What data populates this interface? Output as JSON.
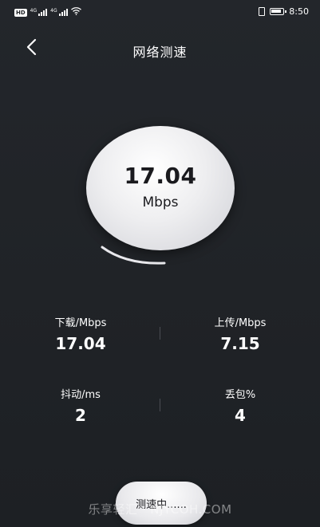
{
  "status_bar": {
    "hd_label": "HD",
    "network1_label": "4G",
    "network2_label": "4G",
    "time": "8:50"
  },
  "header": {
    "title": "网络测速"
  },
  "gauge": {
    "speed_value": "17.04",
    "speed_unit": "Mbps"
  },
  "stats": {
    "download": {
      "label": "下载/Mbps",
      "value": "17.04"
    },
    "upload": {
      "label": "上传/Mbps",
      "value": "7.15"
    },
    "jitter": {
      "label": "抖动/ms",
      "value": "2"
    },
    "packet_loss": {
      "label": "丢包%",
      "value": "4"
    }
  },
  "action": {
    "testing_label": "测速中......"
  },
  "watermark": "乐享轻汇 · NJYCOH.COM",
  "colors": {
    "background": "#202327",
    "gauge_fill": "#eeeef0",
    "text_light": "#ffffff",
    "text_dark": "#1a1a1e"
  },
  "icons": {
    "back": "chevron-left-icon",
    "wifi": "wifi-icon",
    "vibrate": "vibrate-icon",
    "battery": "battery-icon"
  }
}
